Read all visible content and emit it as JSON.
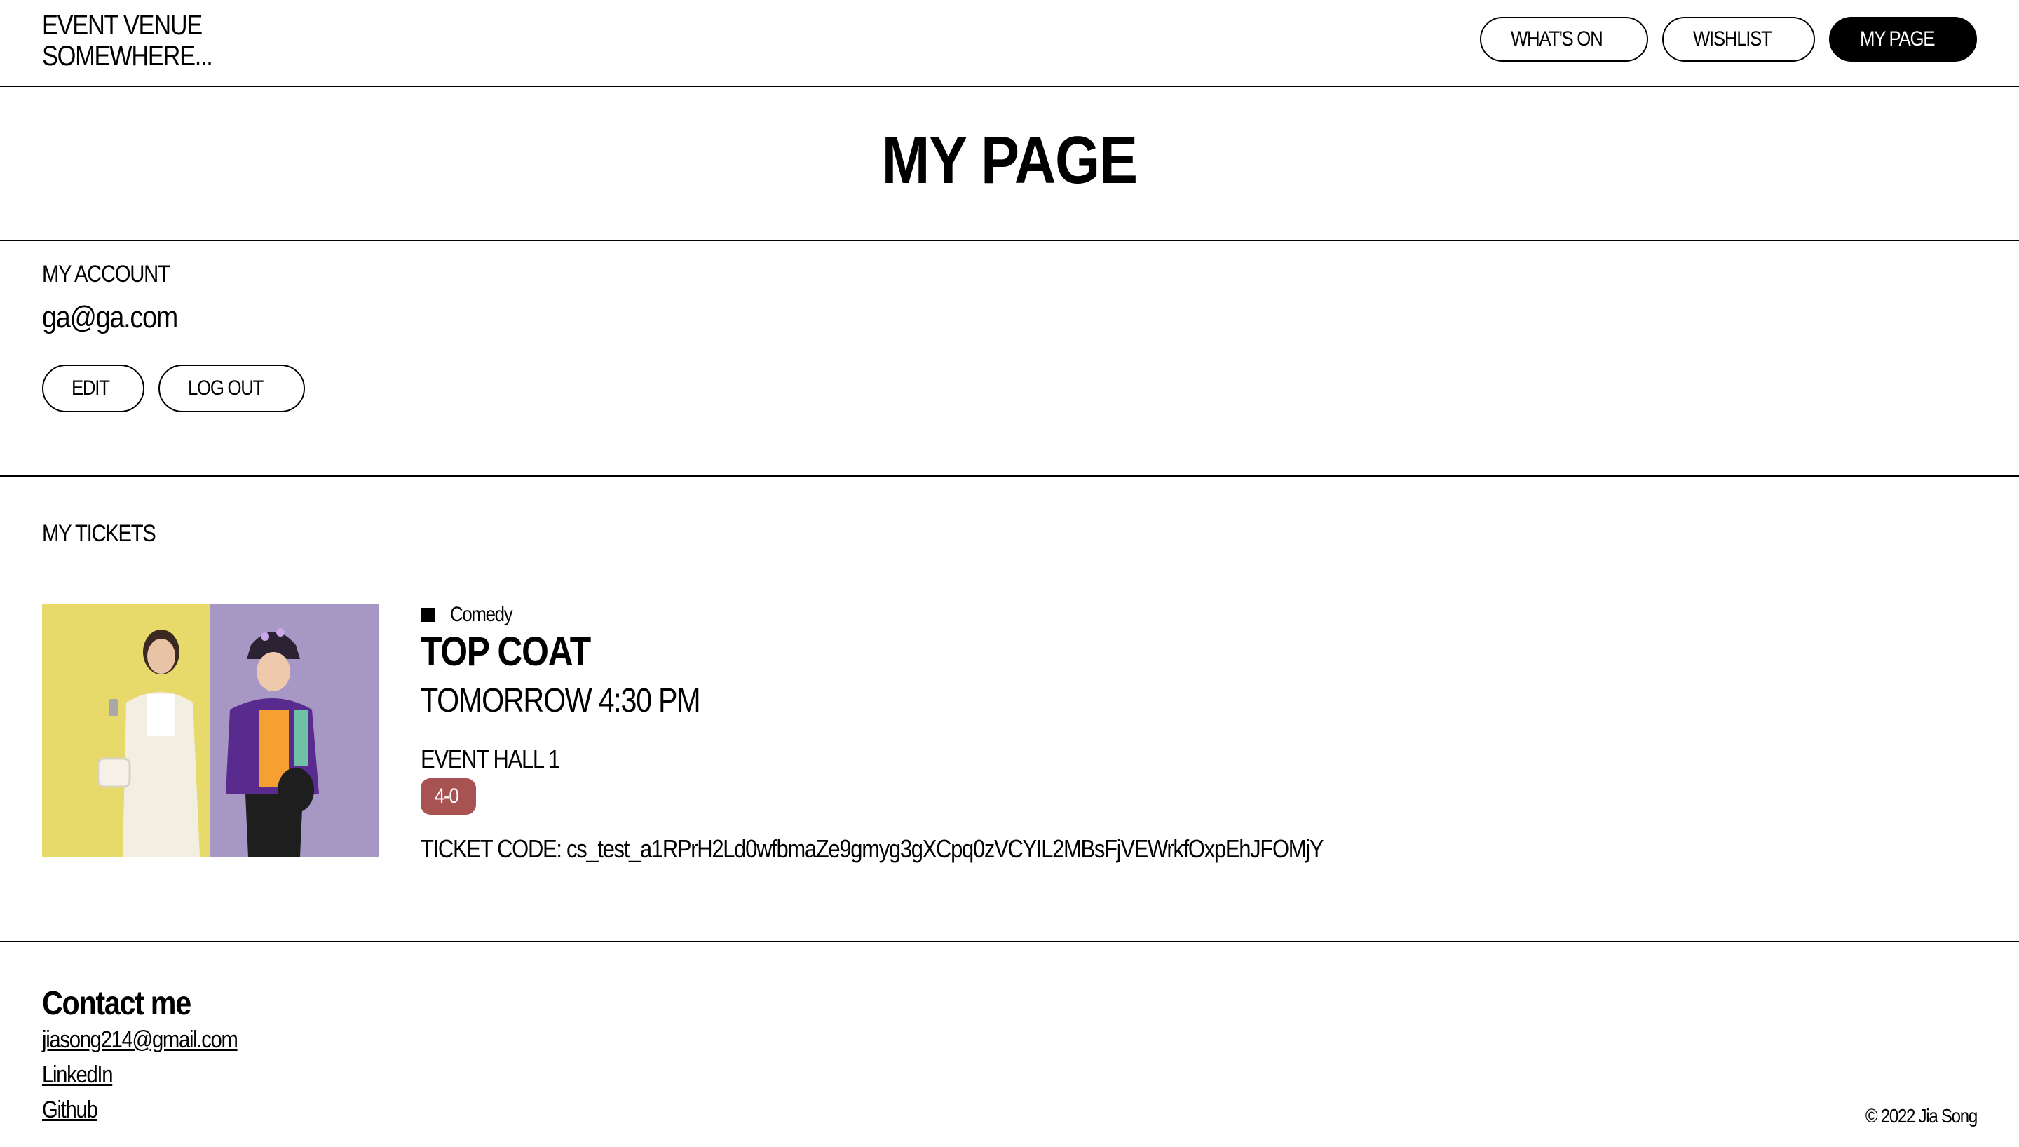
{
  "header": {
    "brand_line1": "EVENT VENUE",
    "brand_line2": "SOMEWHERE...",
    "nav": {
      "whats_on": "WHAT'S ON",
      "wishlist": "WISHLIST",
      "my_page": "MY PAGE"
    }
  },
  "page_title": "MY PAGE",
  "account": {
    "label": "MY ACCOUNT",
    "email": "ga@ga.com",
    "edit_label": "EDIT",
    "logout_label": "LOG OUT"
  },
  "tickets": {
    "label": "MY TICKETS",
    "items": [
      {
        "category": "Comedy",
        "name": "TOP COAT",
        "time": "TOMORROW 4:30 PM",
        "hall": "EVENT HALL 1",
        "seat": "4-0",
        "code": "TICKET CODE: cs_test_a1RPrH2Ld0wfbmaZe9gmyg3gXCpq0zVCYIL2MBsFjVEWrkfOxpEhJFOMjY"
      }
    ]
  },
  "footer": {
    "contact_title": "Contact me",
    "email": "jiasong214@gmail.com",
    "linkedin": "LinkedIn",
    "github": "Github",
    "copyright": "© 2022 Jia Song"
  },
  "colors": {
    "seat_badge": "#a85252",
    "image_left_bg": "#e8da6a",
    "image_right_bg": "#a697c4"
  }
}
